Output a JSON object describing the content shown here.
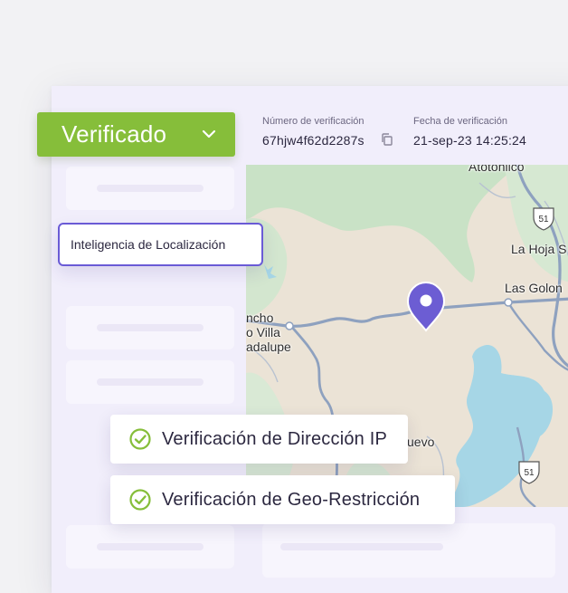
{
  "status": {
    "label": "Verificado",
    "color": "#86be3a",
    "icon": "chevron-down-icon"
  },
  "meta": {
    "verification_number_label": "Número de verificación",
    "verification_number": "67hjw4f62d2287s",
    "verification_date_label": "Fecha de verificación",
    "verification_date": "21-sep-23 14:25:24",
    "copy_icon": "copy-icon"
  },
  "map": {
    "labels": {
      "atotonilco": "Atotonilco",
      "la_hoja": "La Hoja S",
      "las_golon": "Las Golon",
      "rancho_line1": "ncho",
      "rancho_line2": "o Villa",
      "rancho_line3": "adalupe",
      "nuevo": "uevo"
    },
    "shields": [
      "51",
      "51"
    ],
    "pin_icon": "location-pin-icon",
    "colors": {
      "land": "#ebe3d6",
      "water": "#a6d6e6",
      "road": "#8ea1bf",
      "pin": "#6c5dd3"
    }
  },
  "tooltip": {
    "label": "Inteligencia de Localización",
    "border_color": "#6a5bd6"
  },
  "checks": [
    {
      "label": "Verificación de Dirección IP",
      "icon": "check-circle-icon"
    },
    {
      "label": "Verificación de Geo-Restricción",
      "icon": "check-circle-icon"
    }
  ],
  "accent_color": "#86be3a"
}
